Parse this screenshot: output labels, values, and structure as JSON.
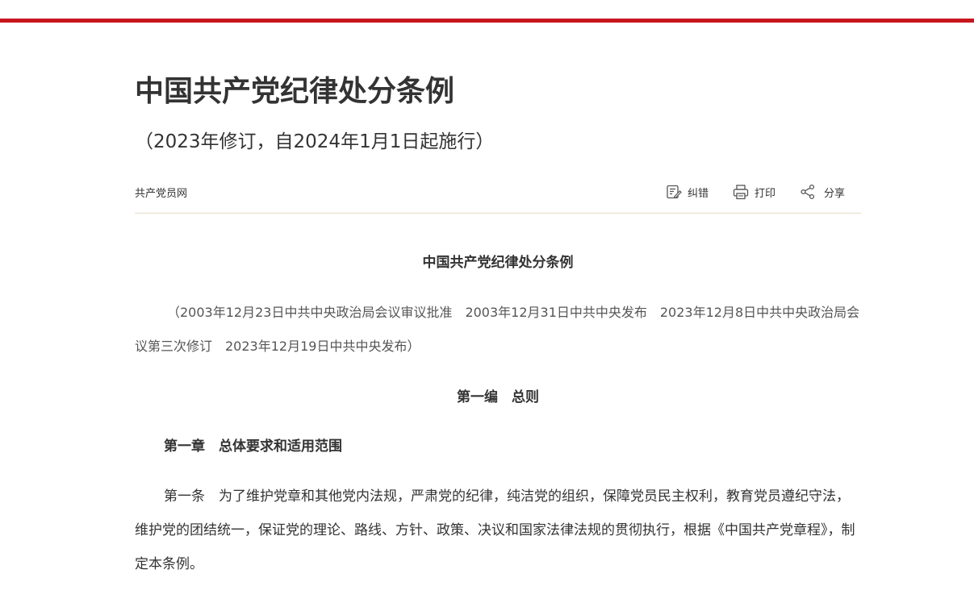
{
  "header": {
    "accent_color": "#c8161e"
  },
  "title": "中国共产党纪律处分条例",
  "subtitle": "（2023年修订，自2024年1月1日起施行）",
  "meta": {
    "source": "共产党员网",
    "tools": {
      "correct_label": "纠错",
      "correct_icon": "edit-icon",
      "print_label": "打印",
      "print_icon": "printer-icon",
      "share_label": "分享",
      "share_icon": "share-icon"
    }
  },
  "article": {
    "title": "中国共产党纪律处分条例",
    "origin": "（2003年12月23日中共中央政治局会议审议批准　2003年12月31日中共中央发布　2023年12月8日中共中央政治局会议第三次修订　2023年12月19日中共中央发布）",
    "part_heading": "第一编　总则",
    "chapter_heading": "第一章　总体要求和适用范围",
    "paragraphs": [
      "第一条　为了维护党章和其他党内法规，严肃党的纪律，纯洁党的组织，保障党员民主权利，教育党员遵纪守法，维护党的团结统一，保证党的理论、路线、方针、政策、决议和国家法律法规的贯彻执行，根据《中国共产党章程》，制定本条例。"
    ]
  }
}
